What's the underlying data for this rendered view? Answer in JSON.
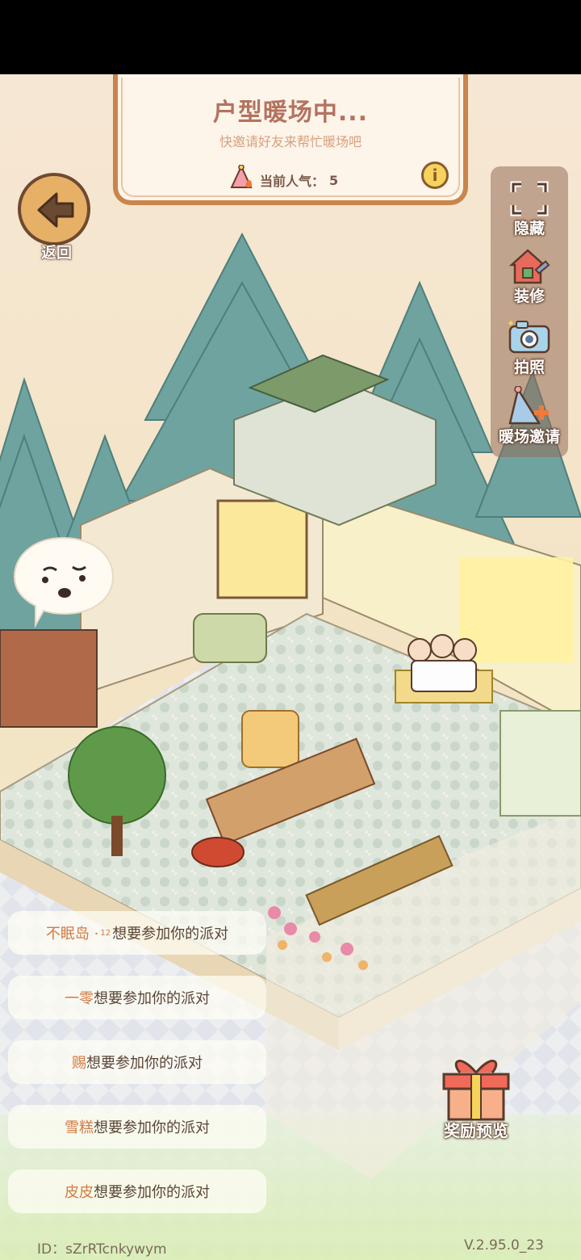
{
  "card": {
    "title": "户型暖场中...",
    "subtitle": "快邀请好友来帮忙暖场吧",
    "popularity_label": "当前人气：",
    "popularity_value": "5",
    "info_icon": "info-icon"
  },
  "back": {
    "label": "返回",
    "icon": "arrow-left-icon"
  },
  "toolbar": [
    {
      "label": "隐藏",
      "icon": "fullscreen-icon"
    },
    {
      "label": "装修",
      "icon": "house-wrench-icon"
    },
    {
      "label": "拍照",
      "icon": "camera-icon"
    },
    {
      "label": "暖场邀请",
      "icon": "party-hat-icon"
    }
  ],
  "invites": [
    {
      "name": "不眠岛 · ",
      "sup": "12",
      "text": "想要参加你的派对"
    },
    {
      "name": "一零",
      "sup": "",
      "text": "想要参加你的派对"
    },
    {
      "name": "赐",
      "sup": "",
      "text": "想要参加你的派对"
    },
    {
      "name": "雪糕",
      "sup": "",
      "text": "想要参加你的派对"
    },
    {
      "name": "皮皮",
      "sup": "",
      "text": "想要参加你的派对"
    }
  ],
  "reward": {
    "label": "奖励预览",
    "icon": "gift-box-icon"
  },
  "footer": {
    "id": "ID：sZrRTcnkywym",
    "version": "V.2.95.0_23"
  },
  "colors": {
    "accent": "#d27b43",
    "card_border": "#c9854c",
    "floor": "#e9e4cc",
    "trees": "#6fa3a0"
  }
}
